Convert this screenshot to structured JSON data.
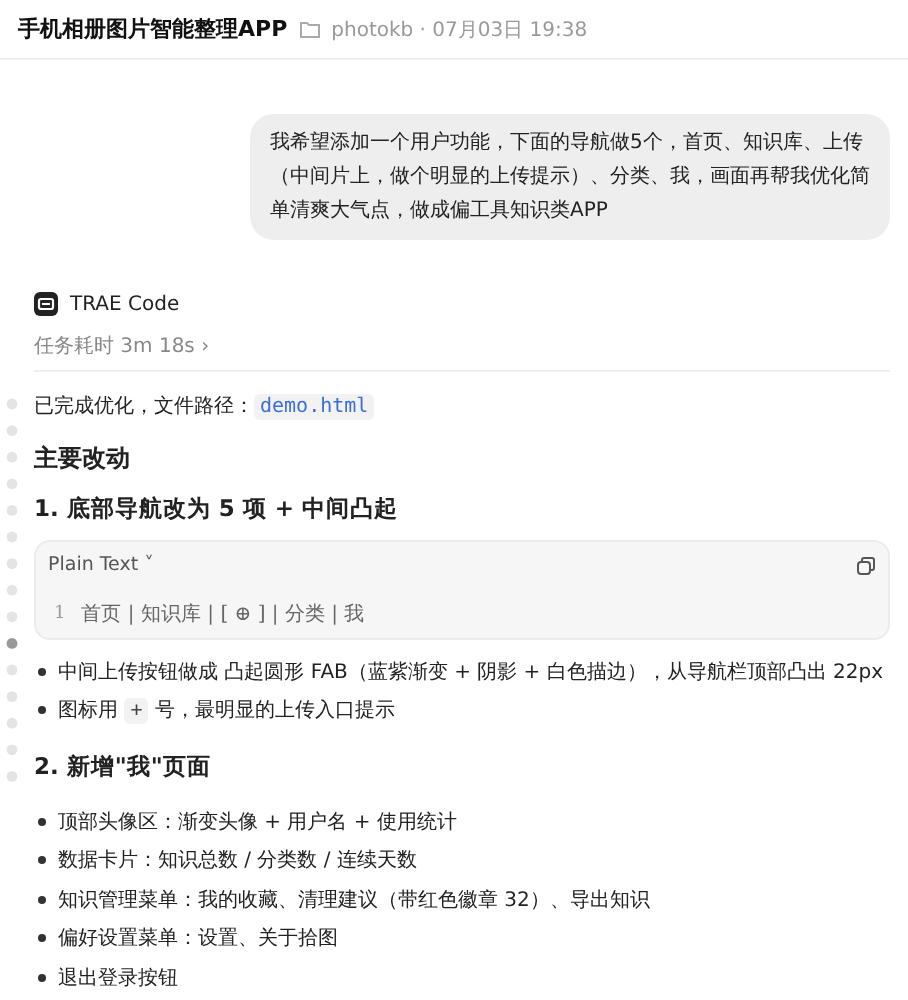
{
  "header": {
    "title": "手机相册图片智能整理APP",
    "meta": "photokb · 07月03日 19:38"
  },
  "user_message": "我希望添加一个用户功能，下面的导航做5个，首页、知识库、上传（中间片上，做个明显的上传提示）、分类、我，画面再帮我优化简单清爽大气点，做成偏工具知识类APP",
  "assistant": {
    "name": "TRAE Code",
    "duration": "任务耗时 3m 18s ›"
  },
  "content": [
    {
      "kind": "para",
      "parts": [
        {
          "text": "已完成优化，文件路径："
        },
        {
          "code": "demo.html"
        }
      ]
    },
    {
      "kind": "h2",
      "text": "主要改动"
    },
    {
      "kind": "h3",
      "text": "1. 底部导航改为 5 项 + 中间凸起"
    },
    {
      "kind": "code",
      "language": "Plain Text ˅",
      "lines": [
        {
          "number": "1",
          "text": "首页 | 知识库 | [ ⊕ ] | 分类 | 我"
        }
      ]
    },
    {
      "kind": "bullet",
      "parts": [
        {
          "text": "中间上传按钮做成 凸起圆形 FAB（蓝紫渐变 + 阴影 + 白色描边），从导航栏顶部凸出 22px"
        }
      ]
    },
    {
      "kind": "bullet",
      "parts": [
        {
          "text": "图标用 "
        },
        {
          "code": "+"
        },
        {
          "text": " 号，最明显的上传入口提示"
        }
      ]
    },
    {
      "kind": "h3",
      "text": "2. 新增\"我\"页面"
    },
    {
      "kind": "bullet",
      "parts": [
        {
          "text": "顶部头像区：渐变头像 + 用户名 + 使用统计"
        }
      ]
    },
    {
      "kind": "bullet",
      "parts": [
        {
          "text": "数据卡片：知识总数 / 分类数 / 连续天数"
        }
      ]
    },
    {
      "kind": "bullet",
      "parts": [
        {
          "text": "知识管理菜单：我的收藏、清理建议（带红色徽章 32）、导出知识"
        }
      ]
    },
    {
      "kind": "bullet",
      "parts": [
        {
          "text": "偏好设置菜单：设置、关于拾图"
        }
      ]
    },
    {
      "kind": "bullet",
      "parts": [
        {
          "text": "退出登录按钮"
        }
      ]
    }
  ]
}
